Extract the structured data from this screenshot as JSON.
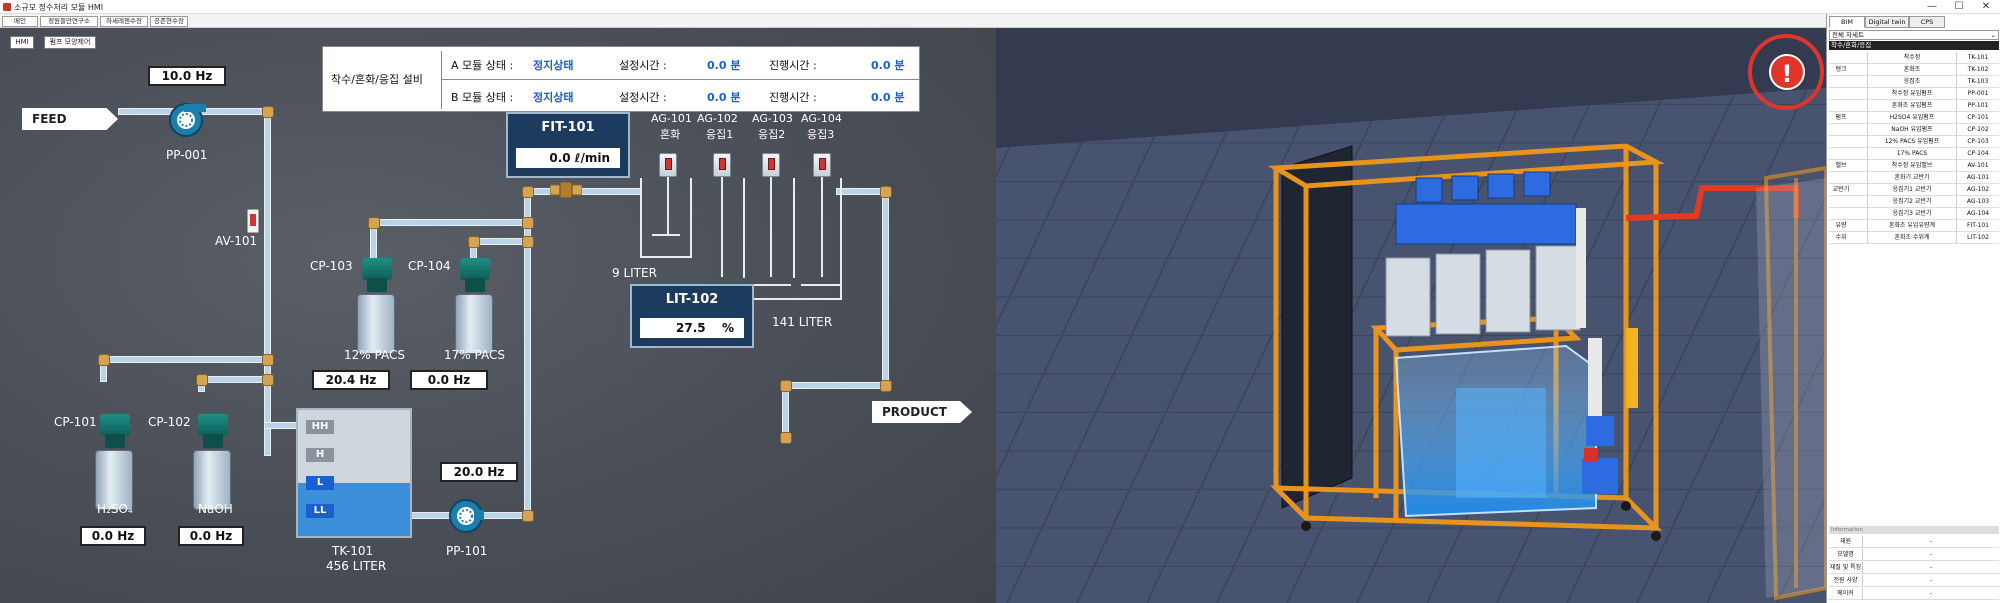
{
  "window": {
    "title": "소규모 정수처리 모듈 HMI",
    "minimize": "—",
    "maximize": "☐",
    "close": "✕"
  },
  "menu": {
    "items": [
      "메인",
      "정원들만연구소",
      "하세레젠수장",
      "공존현수장"
    ]
  },
  "hmi": {
    "buttons": {
      "hmi": "HMI",
      "map": "펌프 모양제어"
    },
    "status": {
      "group_label": "착수/혼화/응집 설비",
      "a_label": "A 모듈 상태 :",
      "a_state": "정지상태",
      "a_set_label": "설정시간 :",
      "a_set": "0.0 분",
      "a_run_label": "진행시간 :",
      "a_run": "0.0 분",
      "b_label": "B 모듈 상태 :",
      "b_state": "정지상태",
      "b_set_label": "설정시간 :",
      "b_set": "0.0 분",
      "b_run_label": "진행시간 :",
      "b_run": "0.0 분"
    },
    "feed": "FEED",
    "product": "PRODUCT",
    "pp001": {
      "label": "PP-001",
      "freq": "10.0 Hz"
    },
    "av101": {
      "label": "AV-101"
    },
    "pp101": {
      "label": "PP-101",
      "freq": "20.0 Hz"
    },
    "cp101": {
      "label": "CP-101",
      "chem": "H₂SO₄",
      "freq": "0.0 Hz"
    },
    "cp102": {
      "label": "CP-102",
      "chem": "NaOH",
      "freq": "0.0 Hz"
    },
    "cp103": {
      "label": "CP-103",
      "chem": "12% PACS",
      "freq": "20.4 Hz"
    },
    "cp104": {
      "label": "CP-104",
      "chem": "17% PACS",
      "freq": "0.0 Hz"
    },
    "tk101": {
      "label": "TK-101",
      "volume": "456 LITER",
      "levels": [
        "HH",
        "H",
        "L",
        "LL"
      ],
      "level_fraction": 0.42
    },
    "fit101": {
      "title": "FIT-101",
      "value": "0.0  ℓ/min"
    },
    "lit102": {
      "title": "LIT-102",
      "value": "27.5",
      "unit": "%"
    },
    "agitators": [
      {
        "tag": "AG-101",
        "name": "혼화"
      },
      {
        "tag": "AG-102",
        "name": "응집1"
      },
      {
        "tag": "AG-103",
        "name": "응집2"
      },
      {
        "tag": "AG-104",
        "name": "응집3"
      }
    ],
    "mix_volume": "9 LITER",
    "floc_volume": "141 LITER"
  },
  "view3d": {
    "alarm_symbol": "!"
  },
  "panel": {
    "tabs": [
      "BIM",
      "Digital twin",
      "CPS"
    ],
    "active_tab": "BIM",
    "dropdown": "전체 차세트",
    "tree_header": "착수/혼화/응집",
    "rows": [
      {
        "group": "",
        "name": "착수정",
        "code": "TK-101"
      },
      {
        "group": "탱크",
        "name": "혼화조",
        "code": "TK-102"
      },
      {
        "group": "",
        "name": "응집조",
        "code": "TK-103"
      },
      {
        "group": "",
        "name": "착수정 유입펌프",
        "code": "PP-001"
      },
      {
        "group": "",
        "name": "혼화조 유입펌프",
        "code": "PP-101"
      },
      {
        "group": "펌프",
        "name": "H2SO4 유입펌프",
        "code": "CP-101"
      },
      {
        "group": "",
        "name": "NaOH 유입펌프",
        "code": "CP-102"
      },
      {
        "group": "",
        "name": "12% PACS 유입펌프",
        "code": "CP-103"
      },
      {
        "group": "",
        "name": "17% PACS",
        "code": "CP-104"
      },
      {
        "group": "밸브",
        "name": "착수정 유입밸브",
        "code": "AV-101"
      },
      {
        "group": "",
        "name": "혼화기 교반기",
        "code": "AG-101"
      },
      {
        "group": "교반기",
        "name": "응집기1 교반기",
        "code": "AG-102"
      },
      {
        "group": "",
        "name": "응집기2 교반기",
        "code": "AG-103"
      },
      {
        "group": "",
        "name": "응집기3 교반기",
        "code": "AG-104"
      },
      {
        "group": "유량",
        "name": "혼화조 유입유량계",
        "code": "FIT-101"
      },
      {
        "group": "수위",
        "name": "혼화조 수위계",
        "code": "LIT-102"
      }
    ],
    "info_header": "Information",
    "info": [
      {
        "key": "재원",
        "value": "-"
      },
      {
        "key": "모델명",
        "value": "-"
      },
      {
        "key": "재질 및 특징",
        "value": "-"
      },
      {
        "key": "전원 사양",
        "value": "-"
      },
      {
        "key": "메이커",
        "value": "-"
      }
    ]
  },
  "colors": {
    "hmi_bg": "#4d5159",
    "pipe": "#b9d4e8",
    "water": "#3a8fd8",
    "alarm": "#e0352b",
    "frame": "#e8941c"
  }
}
